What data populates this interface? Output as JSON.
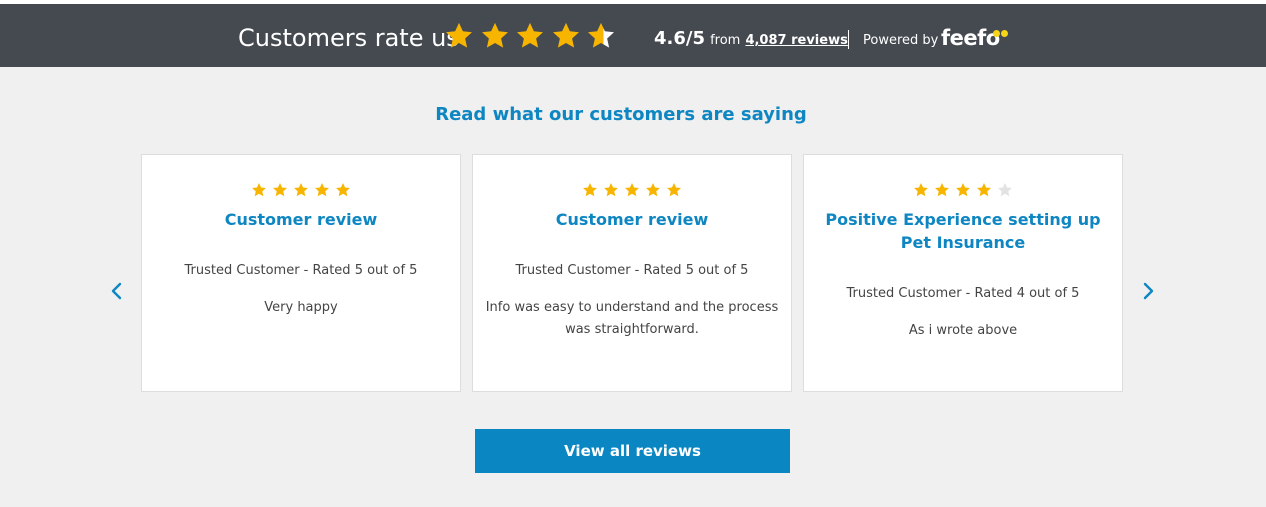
{
  "header": {
    "title": "Customers rate us",
    "rating_stars": 4.6,
    "score": "4.6/5",
    "from_text": "from",
    "reviews_link": "4,087 reviews",
    "powered_by": "Powered by",
    "brand": "feefo"
  },
  "section": {
    "title": "Read what our customers are saying"
  },
  "reviews": [
    {
      "rating": 5,
      "title": "Customer review",
      "meta": "Trusted Customer - Rated 5 out of 5",
      "text": "Very happy"
    },
    {
      "rating": 5,
      "title": "Customer review",
      "meta": "Trusted Customer - Rated 5 out of 5",
      "text": "Info was easy to understand and the process was straightforward."
    },
    {
      "rating": 4,
      "title": "Positive Experience setting up Pet Insurance",
      "meta": "Trusted Customer - Rated 4 out of 5",
      "text": "As i wrote above"
    }
  ],
  "navigation": {
    "prev_icon": "chevron-left-icon",
    "next_icon": "chevron-right-icon"
  },
  "button": {
    "view_all": "View all reviews"
  },
  "colors": {
    "header_bg": "#454a51",
    "section_bg": "#f0f0f0",
    "accent_blue": "#0e86c2",
    "button_blue": "#0a87c3",
    "star_gold": "#f7b500",
    "star_empty": "#e3e3e3",
    "feefo_yellow": "#f5d515"
  }
}
